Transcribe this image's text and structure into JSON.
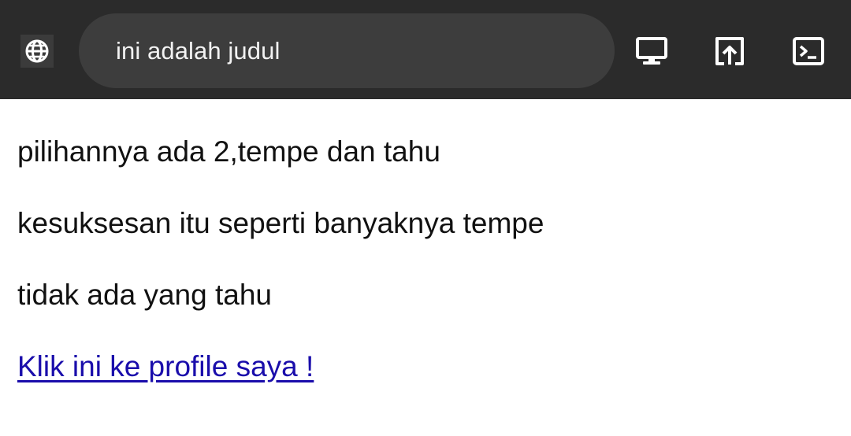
{
  "header": {
    "title": "ini adalah judul",
    "icons": {
      "site": "globe-icon",
      "desktop_mode": "monitor-icon",
      "open_external": "open-in-browser-icon",
      "console": "terminal-icon"
    },
    "colors": {
      "background": "#2b2b2b",
      "pill": "#3d3d3d",
      "text": "#f2f2f2"
    }
  },
  "content": {
    "paragraphs": [
      "pilihannya ada 2,tempe dan tahu",
      "kesuksesan itu seperti banyaknya tempe",
      "tidak ada yang tahu"
    ],
    "link_text": "Klik ini ke profile saya !",
    "colors": {
      "text": "#111111",
      "link": "#1a0dab"
    }
  }
}
